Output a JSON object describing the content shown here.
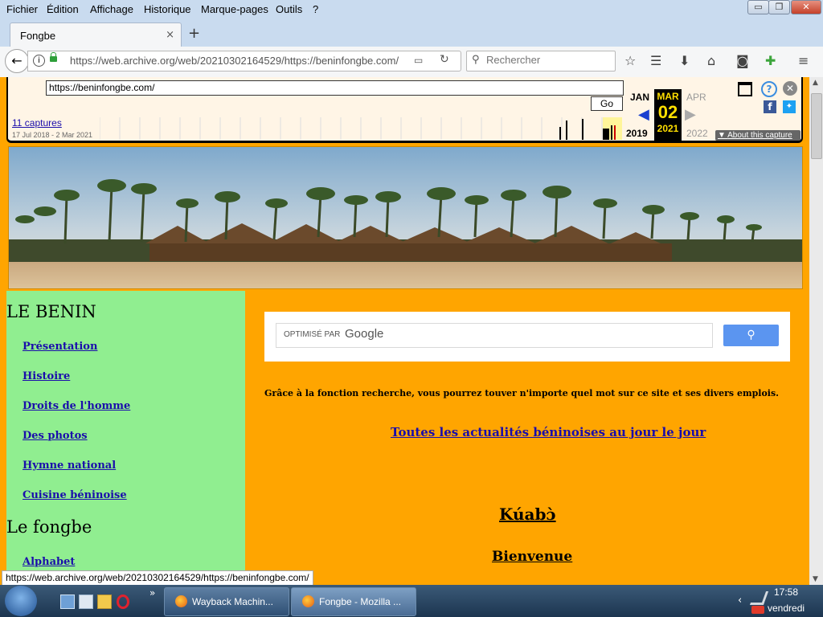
{
  "menubar": {
    "items": [
      "Fichier",
      "Édition",
      "Affichage",
      "Historique",
      "Marque-pages",
      "Outils",
      "?"
    ]
  },
  "window_controls": {
    "minimize": "▭",
    "maximize": "❐",
    "close": "✕"
  },
  "tabs": [
    {
      "title": "Fongbe",
      "close": "×"
    }
  ],
  "new_tab": "+",
  "navbar": {
    "url": "https://web.archive.org/web/20210302164529/https://beninfongbe.com/",
    "search_placeholder": "Rechercher"
  },
  "wayback": {
    "url_value": "https://beninfongbe.com/",
    "go_label": "Go",
    "captures_label": "11 captures",
    "date_range": "17 Jul 2018 - 2 Mar 2021",
    "prev_month": "JAN",
    "cur_month": "MAR",
    "next_month": "APR",
    "prev_year": "2019",
    "cur_day": "02",
    "cur_year": "2021",
    "next_year": "2022",
    "about_label": "About this capture"
  },
  "sidebar": {
    "heading1": "LE BENIN",
    "links1": [
      "Présentation",
      "Histoire",
      "Droits de l'homme",
      "Des photos",
      "Hymne national",
      "Cuisine béninoise"
    ],
    "heading2": "Le fongbe",
    "links2": [
      "Alphabet"
    ]
  },
  "search_widget": {
    "powered_by": "OPTIMISÉ PAR",
    "brand": "Google"
  },
  "main": {
    "intro": "Grâce à la fonction recherche, vous pourrez touver n'importe quel mot sur ce site et ses divers emplois.",
    "news_link": "Toutes les actualités béninoises au jour le jour",
    "kuabo": "Kúabɔ̀",
    "bienvenue": "Bienvenue"
  },
  "statusbar": {
    "hover_url": "https://web.archive.org/web/20210302164529/https://beninfongbe.com/"
  },
  "taskbar": {
    "tasks": [
      "Wayback Machin...",
      "Fongbe - Mozilla ..."
    ],
    "overflow": "»",
    "time": "17:58",
    "day": "vendredi"
  }
}
